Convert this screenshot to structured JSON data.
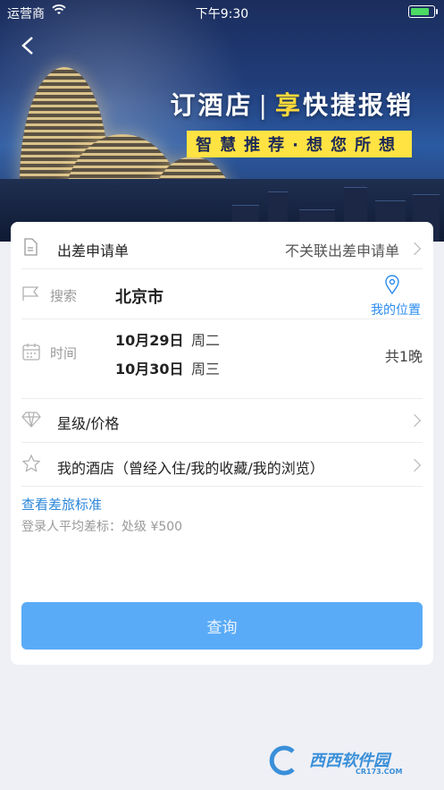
{
  "status_bar": {
    "carrier": "运营商",
    "time": "下午9:30"
  },
  "hero": {
    "title_part1": "订酒店",
    "title_sep": "|",
    "title_highlight": "享",
    "title_part2": "快捷报销",
    "subtitle": "智慧推荐·想您所想"
  },
  "form": {
    "travel_request": {
      "label": "出差申请单",
      "value": "不关联出差申请单"
    },
    "search": {
      "label": "搜索",
      "city": "北京市",
      "location_link": "我的位置"
    },
    "time": {
      "label": "时间",
      "checkin_date": "10月29日",
      "checkin_weekday": "周二",
      "checkout_date": "10月30日",
      "checkout_weekday": "周三",
      "nights": "共1晚"
    },
    "star_price": {
      "label": "星级/价格"
    },
    "my_hotel": {
      "label": "我的酒店（曾经入住/我的收藏/我的浏览）"
    },
    "standard_link": "查看差旅标准",
    "standard_note": "登录人平均差标：处级 ¥500",
    "query_button": "查询"
  },
  "watermark": {
    "text": "西西软件园",
    "sub": "CR173.COM"
  },
  "colors": {
    "accent": "#5aabf7",
    "link": "#2a86d9",
    "highlight": "#ffe343"
  }
}
